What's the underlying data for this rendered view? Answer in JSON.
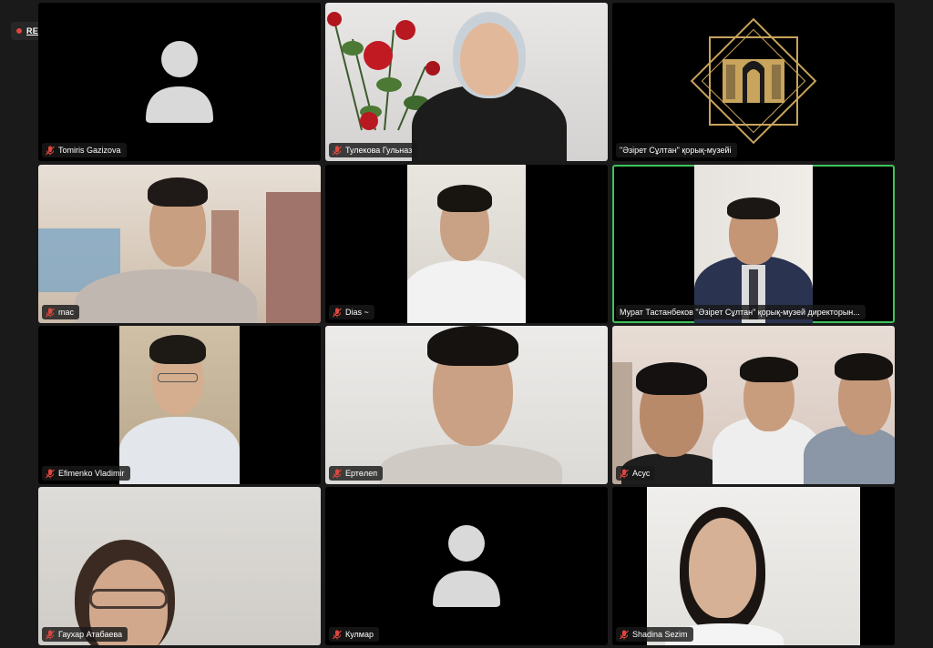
{
  "recording": {
    "label": "REC",
    "dot_color": "#e0463d"
  },
  "colors": {
    "active_speaker": "#3ec45a",
    "muted_mic": "#e0463d",
    "avatar": "#d9d9d9"
  },
  "participants": [
    {
      "name": "Tomiris Gazizova",
      "muted": true,
      "video": false,
      "icon": "person-avatar-icon"
    },
    {
      "name": "Тулекова Гульназ",
      "muted": true,
      "video": true
    },
    {
      "name": "\"Әзірет Сұлтан\" қорық-музейі",
      "muted": false,
      "video": true,
      "icon": "museum-logo-icon"
    },
    {
      "name": "mac",
      "muted": true,
      "video": true
    },
    {
      "name": "Dias ~",
      "muted": true,
      "video": true
    },
    {
      "name": "Мурат Тастанбеков \"Әзірет Сұлтан\" қорық-музей директорын...",
      "muted": false,
      "video": true,
      "active_speaker": true
    },
    {
      "name": "Efimenko Vladimir",
      "muted": true,
      "video": true
    },
    {
      "name": "Ертөлеп",
      "muted": true,
      "video": true
    },
    {
      "name": "Асус",
      "muted": true,
      "video": true
    },
    {
      "name": "Гаухар Атабаева",
      "muted": true,
      "video": true
    },
    {
      "name": "Кулмар",
      "muted": true,
      "video": false,
      "icon": "person-avatar-icon"
    },
    {
      "name": "Shadina Sezim",
      "muted": true,
      "video": true
    }
  ]
}
